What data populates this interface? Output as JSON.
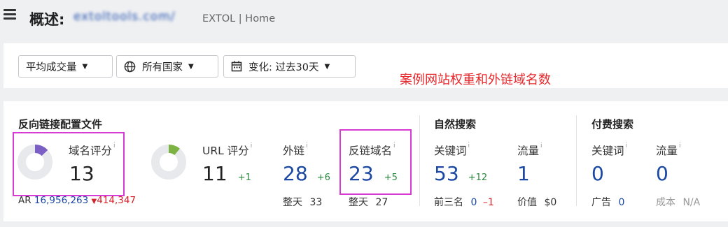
{
  "header": {
    "title": "概述:",
    "domain": "extoltools.com/",
    "subtitle": "EXTOL | Home"
  },
  "filters": {
    "metric": "平均成交量",
    "country": "所有国家",
    "change": "变化: 过去30天"
  },
  "annotation": "案例网站权重和外链域名数",
  "backlinks": {
    "title": "反向链接配置文件",
    "dr": {
      "label": "域名评分",
      "value": "13",
      "percent": 13
    },
    "ar": {
      "label": "AR",
      "value": "16,956,263",
      "delta": "414,347"
    },
    "ur": {
      "label": "URL 评分",
      "value": "11",
      "delta": "+1",
      "percent": 11
    },
    "backlinks": {
      "label": "外链",
      "value": "28",
      "delta": "+6",
      "sub_label": "整天",
      "sub_value": "33"
    },
    "ref_domains": {
      "label": "反链域名",
      "value": "23",
      "delta": "+5",
      "sub_label": "整天",
      "sub_value": "27"
    }
  },
  "organic": {
    "title": "自然搜索",
    "keywords": {
      "label": "关键词",
      "value": "53",
      "delta": "+12",
      "sub_label": "前三名",
      "sub_value": "0",
      "sub_delta": "–1"
    },
    "traffic": {
      "label": "流量",
      "value": "1",
      "sub_label": "价值",
      "sub_value": "$0"
    }
  },
  "paid": {
    "title": "付费搜索",
    "keywords": {
      "label": "关键词",
      "value": "0",
      "sub_label": "广告",
      "sub_value": "0"
    },
    "traffic": {
      "label": "流量",
      "value": "0",
      "sub_label": "成本",
      "sub_value": "N/A"
    }
  },
  "colors": {
    "dr_ring": "#7b5fc4",
    "ur_ring": "#7cb342",
    "ring_bg": "#e8e9ec",
    "annotation": "#e8272b",
    "highlight_box": "#d63bd6"
  },
  "icons": {
    "menu": "hamburger-icon",
    "globe": "globe-icon",
    "calendar": "calendar-icon",
    "caret": "caret-down-icon",
    "info": "info-icon",
    "down_arrow": "down-triangle-icon"
  }
}
